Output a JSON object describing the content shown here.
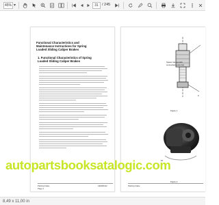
{
  "toolbar": {
    "zoom_value": "45%",
    "page_number": "31",
    "page_total": "/ 245"
  },
  "left_page": {
    "title_line1": "Functional Characteristics and",
    "title_line2": "Maintenance Instructions for Spring",
    "title_line3": "Loaded Sliding Caliper Brakes",
    "section_line1": "1. Functional Characteristics of Spring",
    "section_line2": "Loaded Sliding Caliper Brakes",
    "footer_left": "Parking brake",
    "footer_page": "Page 4",
    "footer_right": "UEN00412"
  },
  "right_page": {
    "callout_line1": "Spacer sleeps with",
    "callout_line2": "connected guide bolt",
    "callout_number": "9",
    "figure1_label": "Figure 1",
    "figure2_number": "10",
    "figure2_label": "Figure 2",
    "footer_left": "Parking brake"
  },
  "watermark": "autopartsbooksatalogic.com",
  "status": {
    "page_size": "8,49 x 11,00 in"
  },
  "colors": {
    "watermark": "#c8e627",
    "toolbar_bg": "#f4f4f4"
  }
}
